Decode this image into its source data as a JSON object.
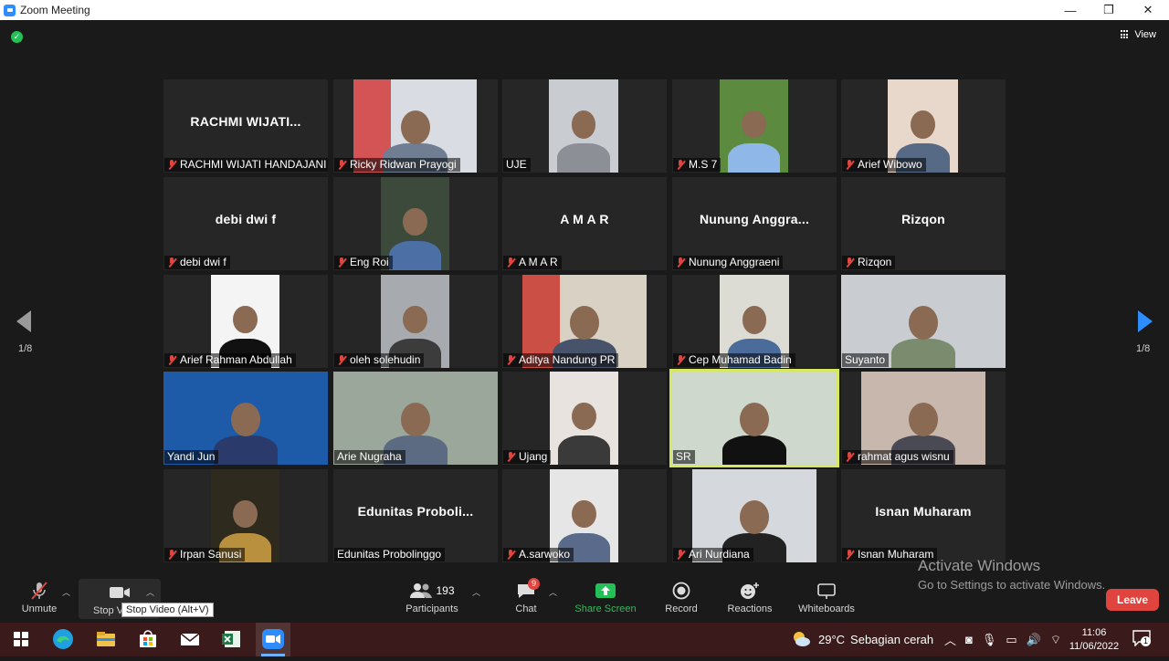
{
  "window": {
    "title": "Zoom Meeting",
    "minimize": "—",
    "restore": "❐",
    "close": "✕"
  },
  "view_label": "View",
  "pagination": {
    "left": "1/8",
    "right": "1/8"
  },
  "participants_grid": [
    {
      "name": "RACHMI WIJATI HANDAJANI",
      "display": "RACHMI WIJATI...",
      "muted": true
    },
    {
      "name": "Ricky Ridwan Prayogi",
      "display": "",
      "muted": true
    },
    {
      "name": "UJE",
      "display": "",
      "muted": false
    },
    {
      "name": "M.S 7",
      "display": "",
      "muted": true
    },
    {
      "name": "Arief Wibowo",
      "display": "",
      "muted": true
    },
    {
      "name": "debi dwi f",
      "display": "debi dwi f",
      "muted": true
    },
    {
      "name": "Eng Roi",
      "display": "",
      "muted": true
    },
    {
      "name": "A M A R",
      "display": "A M A R",
      "muted": true
    },
    {
      "name": "Nunung Anggraeni",
      "display": "Nunung  Anggra...",
      "muted": true
    },
    {
      "name": "Rizqon",
      "display": "Rizqon",
      "muted": true
    },
    {
      "name": "Arief Rahman Abdullah",
      "display": "",
      "muted": true
    },
    {
      "name": "oleh solehudin",
      "display": "",
      "muted": true
    },
    {
      "name": "Aditya Nandung PR",
      "display": "",
      "muted": true
    },
    {
      "name": "Cep Muhamad Badin",
      "display": "",
      "muted": true
    },
    {
      "name": "Suyanto",
      "display": "",
      "muted": false
    },
    {
      "name": "Yandi Jun",
      "display": "",
      "muted": false
    },
    {
      "name": "Arie Nugraha",
      "display": "",
      "muted": false
    },
    {
      "name": "Ujang",
      "display": "",
      "muted": true
    },
    {
      "name": "SR",
      "display": "",
      "muted": false
    },
    {
      "name": "rahmat agus wisnu",
      "display": "",
      "muted": true
    },
    {
      "name": "Irpan Sanusi",
      "display": "",
      "muted": true
    },
    {
      "name": "Edunitas Probolinggo",
      "display": "Edunitas  Proboli...",
      "muted": false
    },
    {
      "name": "A.sarwoko",
      "display": "",
      "muted": true
    },
    {
      "name": "Ari Nurdiana",
      "display": "",
      "muted": true
    },
    {
      "name": "Isnan Muharam",
      "display": "Isnan Muharam",
      "muted": true
    }
  ],
  "toolbar": {
    "unmute": "Unmute",
    "stop_video": "Stop V",
    "participants": "Participants",
    "participants_count": "193",
    "chat": "Chat",
    "chat_badge": "9",
    "share_screen": "Share Screen",
    "record": "Record",
    "reactions": "Reactions",
    "whiteboards": "Whiteboards",
    "leave": "Leave"
  },
  "tooltip": "Stop Video (Alt+V)",
  "watermark": {
    "line1": "Activate Windows",
    "line2": "Go to Settings to activate Windows."
  },
  "taskbar": {
    "weather_temp": "29°C",
    "weather_text": "Sebagian cerah",
    "time": "11:06",
    "date": "11/06/2022",
    "notif_count": "1"
  },
  "colors": {
    "accent": "#2d8cff",
    "leave": "#e0443e",
    "active_speaker": "#d6e861",
    "share": "#23c057"
  }
}
